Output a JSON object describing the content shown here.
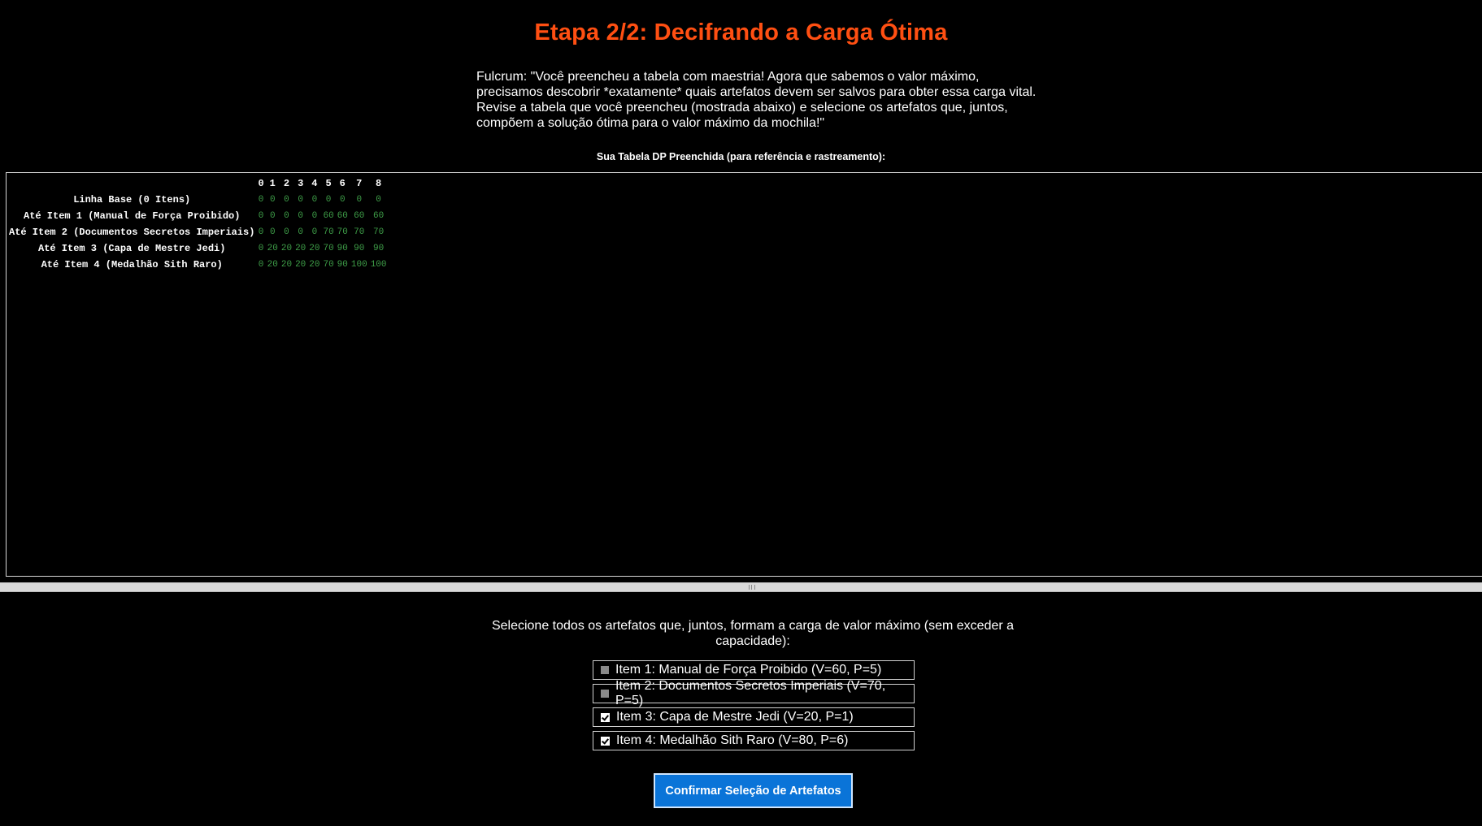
{
  "title": "Etapa 2/2: Decifrando a Carga Ótima",
  "intro": "Fulcrum: \"Você preencheu a tabela com maestria! Agora que sabemos o valor máximo, precisamos descobrir *exatamente* quais artefatos devem ser salvos para obter essa carga vital. Revise a tabela que você preencheu (mostrada abaixo) e selecione os artefatos que, juntos, compõem a solução ótima para o valor máximo da mochila!\"",
  "table_caption": "Sua Tabela DP Preenchida (para referência e rastreamento):",
  "dp_table": {
    "columns": [
      "0",
      "1",
      "2",
      "3",
      "4",
      "5",
      "6",
      "7",
      "8"
    ],
    "rows": [
      {
        "label": "Linha Base (0 Itens)",
        "cells": [
          "0",
          "0",
          "0",
          "0",
          "0",
          "0",
          "0",
          "0",
          "0"
        ]
      },
      {
        "label": "Até Item 1 (Manual de Força Proibido)",
        "cells": [
          "0",
          "0",
          "0",
          "0",
          "0",
          "60",
          "60",
          "60",
          "60"
        ]
      },
      {
        "label": "Até Item 2 (Documentos Secretos Imperiais)",
        "cells": [
          "0",
          "0",
          "0",
          "0",
          "0",
          "70",
          "70",
          "70",
          "70"
        ]
      },
      {
        "label": "Até Item 3 (Capa de Mestre Jedi)",
        "cells": [
          "0",
          "20",
          "20",
          "20",
          "20",
          "70",
          "90",
          "90",
          "90"
        ]
      },
      {
        "label": "Até Item 4 (Medalhão Sith Raro)",
        "cells": [
          "0",
          "20",
          "20",
          "20",
          "20",
          "70",
          "90",
          "100",
          "100"
        ]
      }
    ]
  },
  "prompt": "Selecione todos os artefatos que, juntos, formam a carga de valor máximo (sem exceder a capacidade):",
  "options": [
    {
      "label": "Item 1: Manual de Força Proibido (V=60, P=5)",
      "checked": false
    },
    {
      "label": "Item 2: Documentos Secretos Imperiais (V=70, P=5)",
      "checked": false
    },
    {
      "label": "Item 3: Capa de Mestre Jedi (V=20, P=1)",
      "checked": true
    },
    {
      "label": "Item 4: Medalhão Sith Raro (V=80, P=6)",
      "checked": true
    }
  ],
  "confirm_label": "Confirmar Seleção de Artefatos",
  "colors": {
    "title": "#ff4f12",
    "cell_value": "#3e9e48",
    "button": "#0a74d8"
  }
}
